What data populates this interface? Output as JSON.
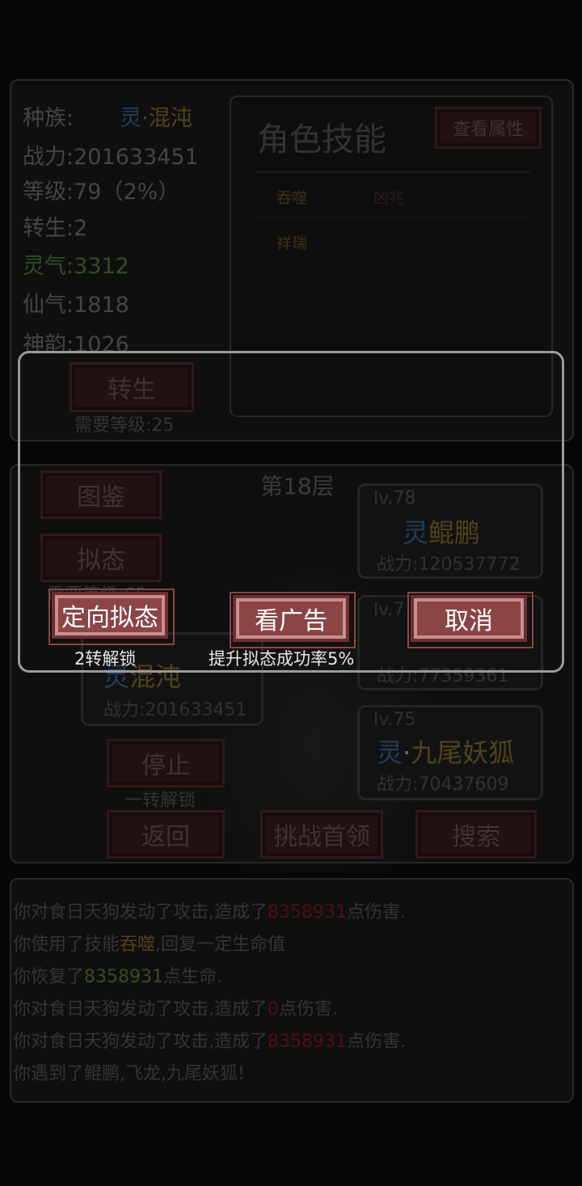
{
  "stats": {
    "race_label": "种族:",
    "race_prefix": "灵",
    "race_sep": "·",
    "race_name": "混沌",
    "power": "战力:201633451",
    "level": "等级:79（2%）",
    "rebirth": "转生:2",
    "lingqi": "灵气:3312",
    "xianqi": "仙气:1818",
    "shenyun": "神韵:1026"
  },
  "rebirth_panel": {
    "button": "转生",
    "requirement": "需要等级:25"
  },
  "skills": {
    "title": "角色技能",
    "view_attr_button": "查看属性",
    "items": [
      "吞噬",
      "凶兆",
      "祥瑞"
    ]
  },
  "battle": {
    "floor": "第18层",
    "left_buttons": [
      "图鉴",
      "拟态"
    ],
    "left_hint": "需要等级:65",
    "player_card": {
      "prefix": "灵",
      "name": "混沌",
      "power": "战力:201633451"
    },
    "enemies": [
      {
        "level": "lv.78",
        "prefix": "灵",
        "name": "鲲鹏",
        "power": "战力:120537772"
      },
      {
        "level": "lv.7",
        "prefix": "",
        "name": "",
        "power": "战力:77359361"
      },
      {
        "level": "lv.75",
        "prefix": "灵",
        "name": "九尾妖狐",
        "power": "战力:70437609"
      }
    ],
    "stop_button": "停止",
    "stop_hint": "一转解锁",
    "bottom_buttons": [
      "返回",
      "挑战首领",
      "搜索"
    ]
  },
  "log": [
    {
      "pre": "你对食日天狗发动了攻击,造成了",
      "val": "8358931",
      "post": "点伤害."
    },
    {
      "pre": "你使用了技能",
      "val": "吞噬",
      "post": ",回复一定生命值"
    },
    {
      "pre": "你恢复了",
      "val": "8358931",
      "post": "点生命."
    },
    {
      "pre": "你对食日天狗发动了攻击,造成了",
      "val": "0",
      "post": "点伤害."
    },
    {
      "pre": "你对食日天狗发动了攻击,造成了",
      "val": "8358931",
      "post": "点伤害."
    },
    {
      "pre": "你遇到了鲲鹏,飞龙,九尾妖狐!",
      "val": "",
      "post": ""
    }
  ],
  "dialog": {
    "buttons": [
      {
        "label": "定向拟态",
        "caption": "2转解锁"
      },
      {
        "label": "看广告",
        "caption": "提升拟态成功率5%"
      },
      {
        "label": "取消",
        "caption": ""
      }
    ]
  },
  "colors": {
    "dialog_button": "#8b4545",
    "background": "#0e0e0e",
    "damage_red": "#8a2020",
    "heal_green": "#5a8f3a"
  }
}
